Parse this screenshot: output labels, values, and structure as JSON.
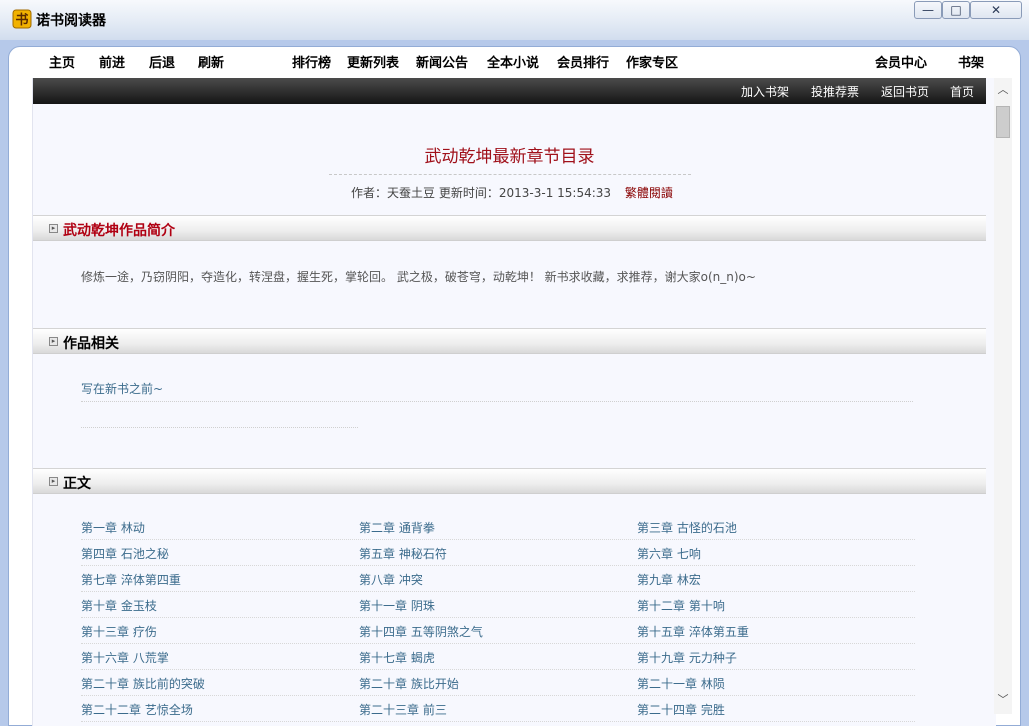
{
  "window": {
    "title": "诺书阅读器",
    "minimize": "—",
    "maximize": "□",
    "close": "✕"
  },
  "nav": {
    "home": "主页",
    "forward": "前进",
    "back": "后退",
    "refresh": "刷新",
    "ranking": "排行榜",
    "updates": "更新列表",
    "news": "新闻公告",
    "full_novels": "全本小说",
    "member_ranking": "会员排行",
    "author_zone": "作家专区",
    "member_center": "会员中心",
    "bookshelf": "书架"
  },
  "toolbar": {
    "add_shelf": "加入书架",
    "vote": "投推荐票",
    "back_book": "返回书页",
    "home": "首页"
  },
  "book": {
    "title": "武动乾坤最新章节目录",
    "author_label": "作者：",
    "author": "天蚕土豆",
    "updated_label": "更新时间：",
    "updated": "2013-3-1 15:54:33",
    "traditional": "繁體閱讀"
  },
  "sections": {
    "intro_title": "武动乾坤作品简介",
    "intro_text": "修炼一途，乃窃阴阳，夺造化，转涅盘，握生死，掌轮回。 武之极，破苍穹，动乾坤！ 新书求收藏，求推荐，谢大家o(n_n)o~",
    "related_title": "作品相关",
    "related_link": "写在新书之前~",
    "body_title": "正文"
  },
  "chapters": [
    [
      "第一章 林动",
      "第二章 通背拳",
      "第三章 古怪的石池"
    ],
    [
      "第四章 石池之秘",
      "第五章 神秘石符",
      "第六章 七响"
    ],
    [
      "第七章 淬体第四重",
      "第八章 冲突",
      "第九章 林宏"
    ],
    [
      "第十章 金玉枝",
      "第十一章 阴珠",
      "第十二章 第十响"
    ],
    [
      "第十三章 疗伤",
      "第十四章 五等阴煞之气",
      "第十五章 淬体第五重"
    ],
    [
      "第十六章 八荒掌",
      "第十七章 蝎虎",
      "第十九章 元力种子"
    ],
    [
      "第二十章 族比前的突破",
      "第二十章 族比开始",
      "第二十一章 林陨"
    ],
    [
      "第二十二章 艺惊全场",
      "第二十三章 前三",
      "第二十四章 完胜"
    ]
  ],
  "scrollbar": {
    "up": "︿",
    "down": "﹀"
  }
}
